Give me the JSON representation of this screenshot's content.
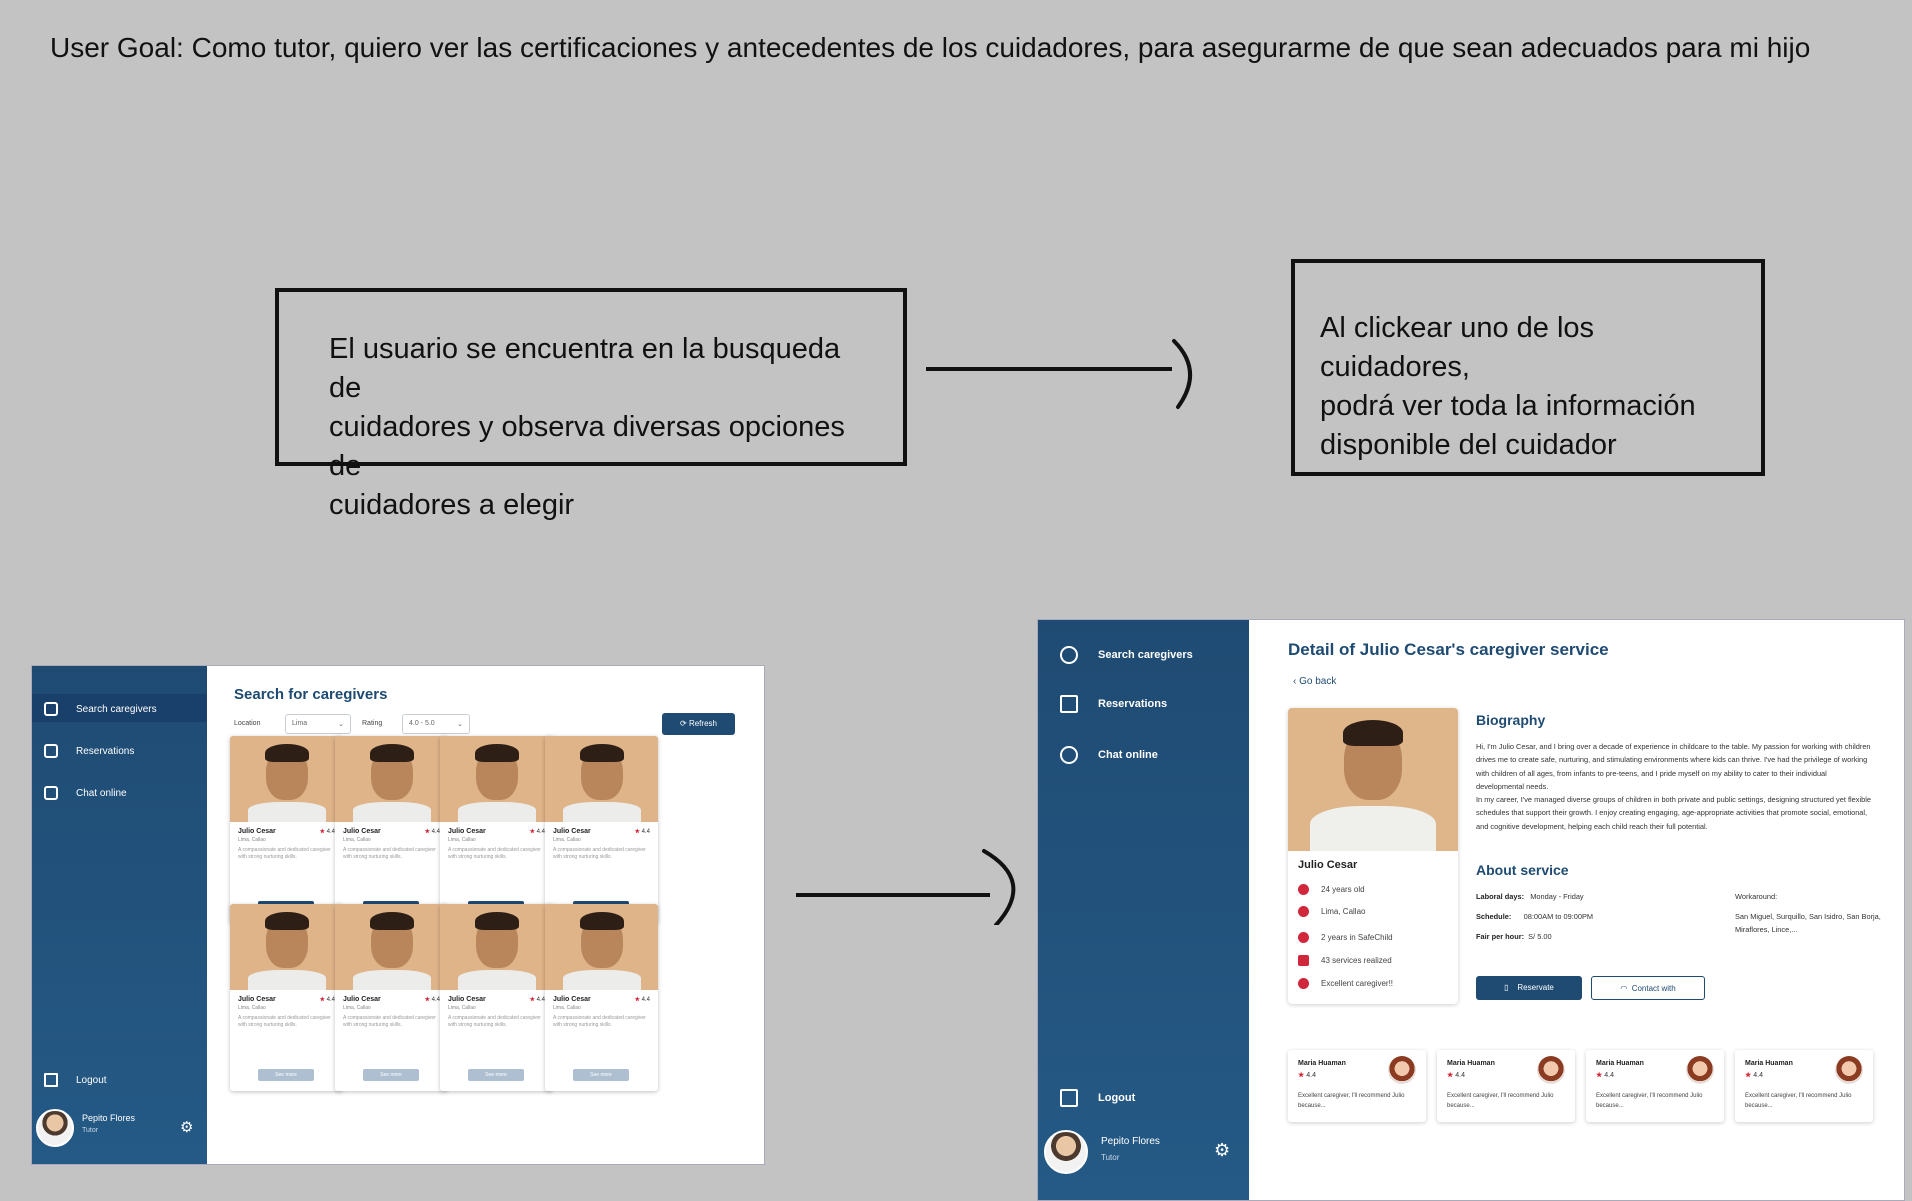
{
  "user_goal": "User Goal: Como tutor, quiero ver las certificaciones y antecedentes de los cuidadores, para asegurarme de que sean adecuados para mi hijo",
  "notes": [
    {
      "lines": [
        "El usuario se encuentra en la busqueda de",
        "cuidadores y observa diversas opciones de",
        "cuidadores a elegir"
      ]
    },
    {
      "lines": [
        "Al clickear uno de los cuidadores,",
        "podrá ver toda la información",
        "disponible del cuidador"
      ]
    }
  ],
  "colors": {
    "primary": "#1f4b73",
    "accent": "#d0273a",
    "background": "#c3c3c3"
  },
  "screen1": {
    "nav": [
      {
        "label": "Search caregivers",
        "icon": "search-icon"
      },
      {
        "label": "Reservations",
        "icon": "notebook-icon"
      },
      {
        "label": "Chat online",
        "icon": "headset-icon"
      }
    ],
    "logout": "Logout",
    "user_name": "Pepito Flores",
    "user_role": "Tutor",
    "title": "Search for caregivers",
    "filter1_label": "Location",
    "filter1_value": "Lima",
    "filter2_label": "Rating",
    "filter2_value": "4.0 - 5.0",
    "refresh": "Refresh",
    "cards": [
      {
        "name": "Julio Cesar",
        "rating": "4.4",
        "sub": "Lima, Callao",
        "desc": "A compassionate and dedicated caregiver with strong nurturing skills.",
        "button": "See more"
      },
      {
        "name": "Julio Cesar",
        "rating": "4.4",
        "sub": "Lima, Callao",
        "desc": "A compassionate and dedicated caregiver with strong nurturing skills.",
        "button": "See more"
      },
      {
        "name": "Julio Cesar",
        "rating": "4.4",
        "sub": "Lima, Callao",
        "desc": "A compassionate and dedicated caregiver with strong nurturing skills.",
        "button": "See more"
      },
      {
        "name": "Julio Cesar",
        "rating": "4.4",
        "sub": "Lima, Callao",
        "desc": "A compassionate and dedicated caregiver with strong nurturing skills.",
        "button": "See more"
      },
      {
        "name": "Julio Cesar",
        "rating": "4.4",
        "sub": "Lima, Callao",
        "desc": "A compassionate and dedicated caregiver with strong nurturing skills.",
        "button": "See more"
      },
      {
        "name": "Julio Cesar",
        "rating": "4.4",
        "sub": "Lima, Callao",
        "desc": "A compassionate and dedicated caregiver with strong nurturing skills.",
        "button": "See more"
      },
      {
        "name": "Julio Cesar",
        "rating": "4.4",
        "sub": "Lima, Callao",
        "desc": "A compassionate and dedicated caregiver with strong nurturing skills.",
        "button": "See more"
      },
      {
        "name": "Julio Cesar",
        "rating": "4.4",
        "sub": "Lima, Callao",
        "desc": "A compassionate and dedicated caregiver with strong nurturing skills.",
        "button": "See more"
      }
    ]
  },
  "screen2": {
    "nav": [
      {
        "label": "Search caregivers",
        "icon": "search-icon"
      },
      {
        "label": "Reservations",
        "icon": "notebook-icon"
      },
      {
        "label": "Chat online",
        "icon": "headset-icon"
      }
    ],
    "logout": "Logout",
    "user_name": "Pepito Flores",
    "user_role": "Tutor",
    "title": "Detail of Julio Cesar's caregiver service",
    "back": "Go back",
    "profile": {
      "name": "Julio Cesar",
      "details": [
        {
          "icon": "person-icon",
          "text": "24 years old"
        },
        {
          "icon": "location-icon",
          "text": "Lima, Callao"
        },
        {
          "icon": "clock-icon",
          "text": "2 years in SafeChild"
        },
        {
          "icon": "briefcase-icon",
          "text": "43 services realized"
        },
        {
          "icon": "smile-icon",
          "text": "Excellent caregiver!!"
        }
      ]
    },
    "biography_title": "Biography",
    "biography_p1": "Hi, I'm Julio Cesar, and I bring over a decade of experience in childcare to the table. My passion for working with children drives me to create safe, nurturing, and stimulating environments where kids can thrive. I've had the privilege of working with children of all ages, from infants to pre-teens, and I pride myself on my ability to cater to their individual developmental needs.",
    "biography_p2": "In my career, I've managed diverse groups of children in both private and public settings, designing structured yet flexible schedules that support their growth. I enjoy creating engaging, age-appropriate activities that promote social, emotional, and cognitive development, helping each child reach their full potential.",
    "about_title": "About service",
    "labor_days_label": "Laboral days:",
    "labor_days_value": "Monday - Friday",
    "schedule_label": "Schedule:",
    "schedule_value": "08:00AM to 09:00PM",
    "fare_label": "Fair per hour:",
    "fare_value": "S/ 5.00",
    "workaround_label": "Workaround:",
    "workaround_value": "San Miguel, Surquillo, San Isidro, San Borja, Miraflores, Lince,...",
    "reservate": "Reservate",
    "contact": "Contact with",
    "reviews": [
      {
        "name": "Maria Huaman",
        "rating": "4.4",
        "text": "Excellent caregiver, I'll recommend Julio because..."
      },
      {
        "name": "Maria Huaman",
        "rating": "4.4",
        "text": "Excellent caregiver, I'll recommend Julio because..."
      },
      {
        "name": "Maria Huaman",
        "rating": "4.4",
        "text": "Excellent caregiver, I'll recommend Julio because..."
      },
      {
        "name": "Maria Huaman",
        "rating": "4.4",
        "text": "Excellent caregiver, I'll recommend Julio because..."
      }
    ]
  }
}
